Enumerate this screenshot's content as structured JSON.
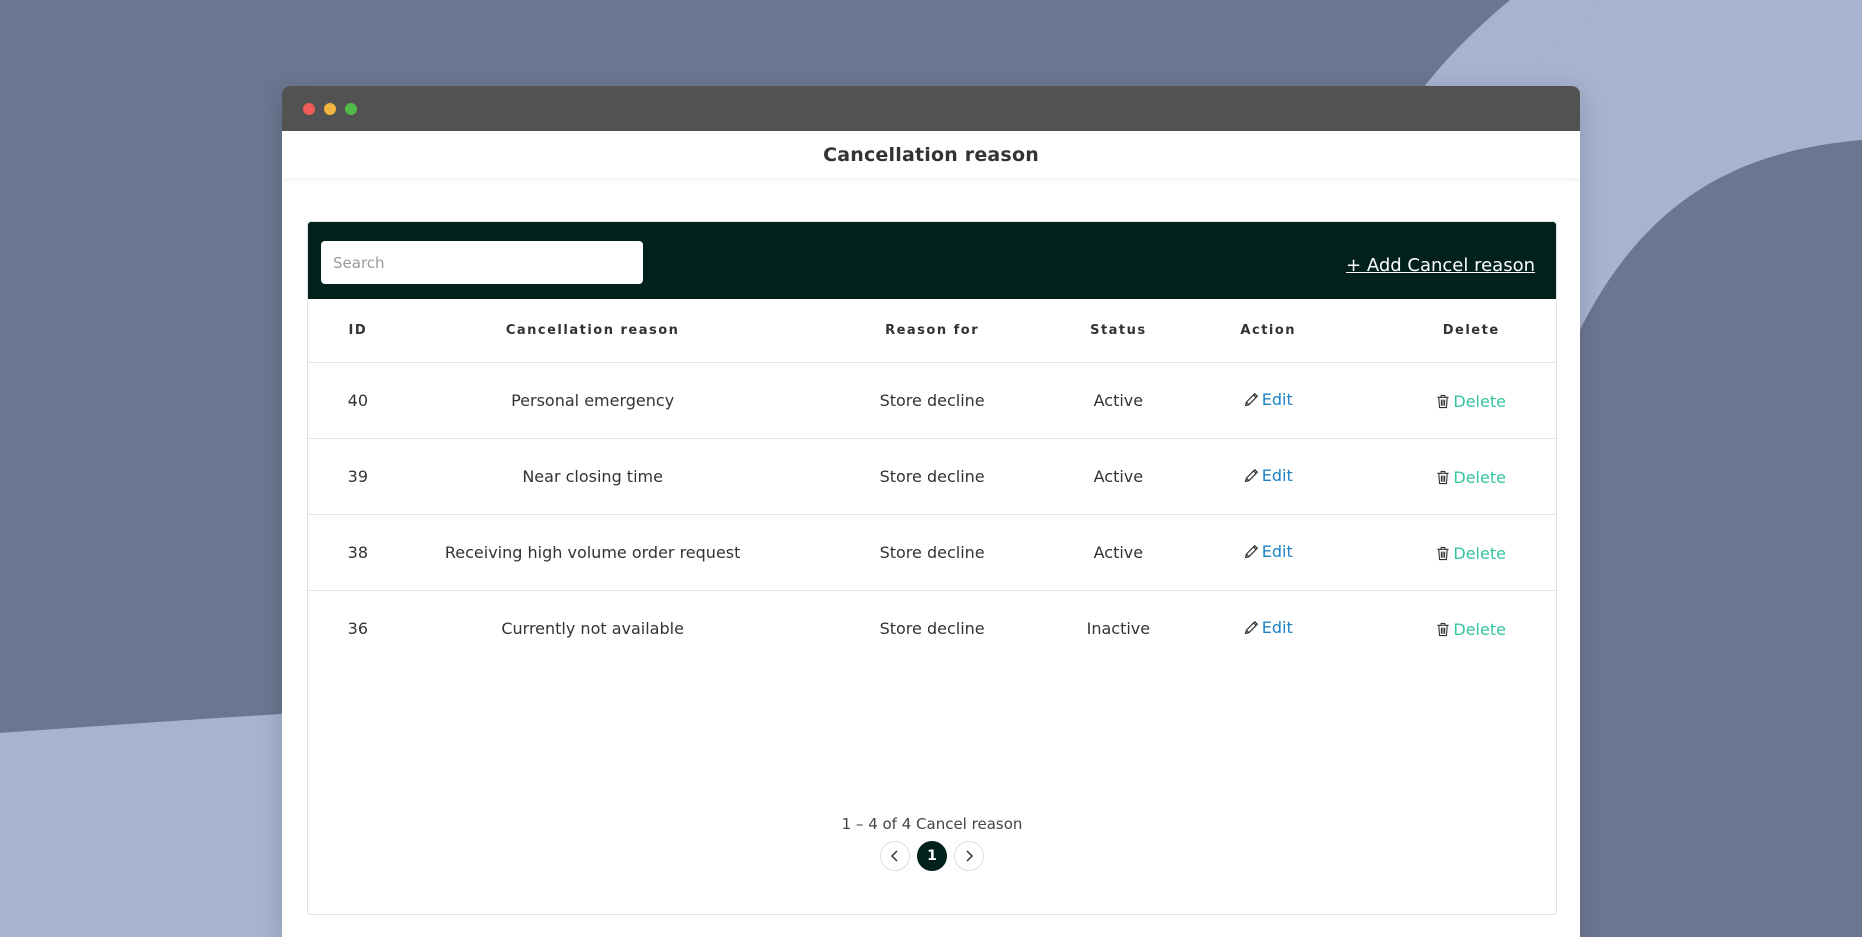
{
  "app": {
    "title": "Cancellation reason"
  },
  "toolbar": {
    "search_placeholder": "Search",
    "add_label": "+ Add Cancel reason"
  },
  "table": {
    "headers": {
      "id": "ID",
      "reason": "Cancellation reason",
      "reason_for": "Reason for",
      "status": "Status",
      "action": "Action",
      "delete": "Delete"
    },
    "rows": [
      {
        "id": "40",
        "reason": "Personal emergency",
        "reason_for": "Store decline",
        "status": "Active",
        "action": "Edit",
        "delete": "Delete"
      },
      {
        "id": "39",
        "reason": "Near closing time",
        "reason_for": "Store decline",
        "status": "Active",
        "action": "Edit",
        "delete": "Delete"
      },
      {
        "id": "38",
        "reason": "Receiving high volume order request",
        "reason_for": "Store decline",
        "status": "Active",
        "action": "Edit",
        "delete": "Delete"
      },
      {
        "id": "36",
        "reason": "Currently not available",
        "reason_for": "Store decline",
        "status": "Inactive",
        "action": "Edit",
        "delete": "Delete"
      }
    ]
  },
  "pagination": {
    "summary": "1 – 4 of 4 Cancel reason",
    "current_page": "1"
  },
  "icons": {
    "edit": "pencil-icon",
    "delete": "trash-icon",
    "prev": "chevron-left-icon",
    "next": "chevron-right-icon"
  },
  "colors": {
    "toolbar_bg": "#03211c",
    "edit_link": "#1d83c3",
    "delete_link": "#35c3a0",
    "window_titlebar": "#525252",
    "page_bg": "#6b7690",
    "page_bg_light": "#a7b3cf"
  }
}
